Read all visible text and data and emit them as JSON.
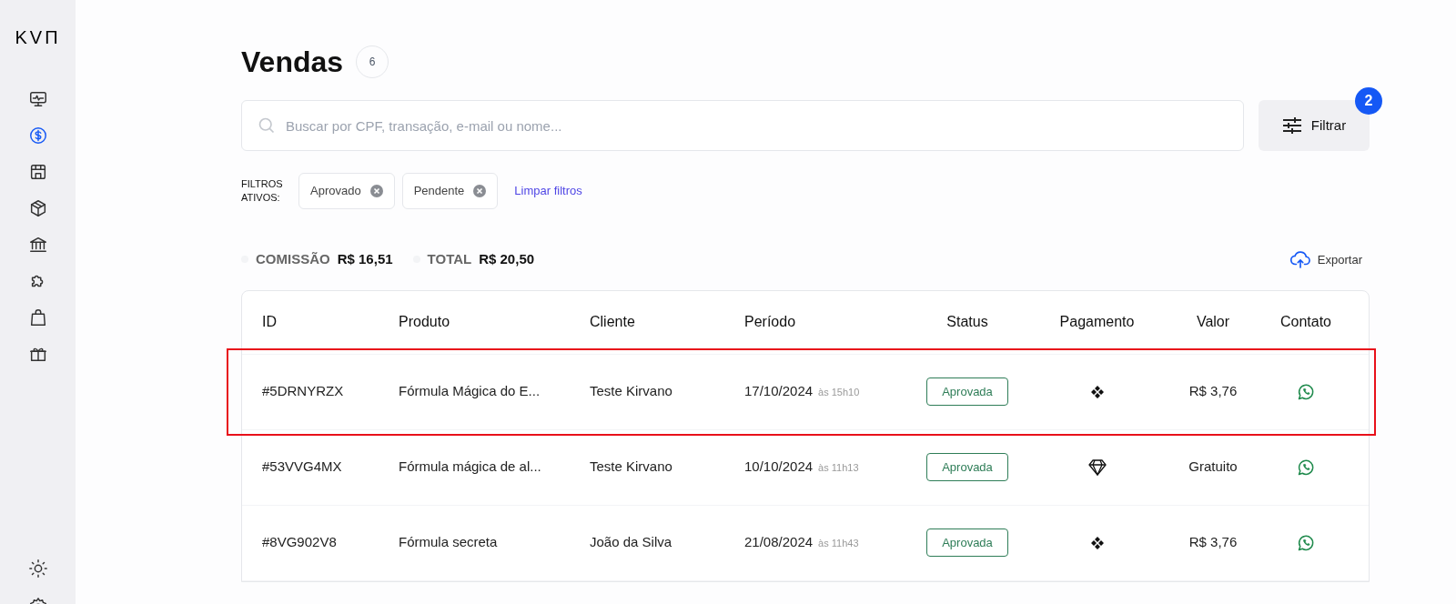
{
  "sidebar": {
    "logo": "KVП",
    "items": [
      {
        "selected": false
      },
      {
        "selected": true
      },
      {
        "selected": false
      },
      {
        "selected": false
      },
      {
        "selected": false
      },
      {
        "selected": false
      },
      {
        "selected": false
      },
      {
        "selected": false
      }
    ]
  },
  "title": "Vendas",
  "count": "6",
  "search": {
    "placeholder": "Buscar por CPF, transação, e-mail ou nome..."
  },
  "filter_button": {
    "label": "Filtrar",
    "badge": "2"
  },
  "active_filters": {
    "label": "FILTROS ATIVOS:",
    "chips": [
      "Aprovado",
      "Pendente"
    ],
    "clear": "Limpar filtros"
  },
  "totals": [
    {
      "label": "COMISSÃO",
      "value": "R$ 16,51"
    },
    {
      "label": "TOTAL",
      "value": "R$ 20,50"
    }
  ],
  "export": "Exportar",
  "table": {
    "columns": [
      "ID",
      "Produto",
      "Cliente",
      "Período",
      "Status",
      "Pagamento",
      "Valor",
      "Contato"
    ],
    "rows": [
      {
        "id": "#5DRNYRZX",
        "product": "Fórmula Mágica do E...",
        "client": "Teste Kirvano",
        "date": "17/10/2024",
        "time": "às 15h10",
        "status": "Aprovada",
        "kind": "pix",
        "value": "R$ 3,76",
        "highlighted": true
      },
      {
        "id": "#53VVG4MX",
        "product": "Fórmula mágica de al...",
        "client": "Teste Kirvano",
        "date": "10/10/2024",
        "time": "às 11h13",
        "status": "Aprovada",
        "kind": "gem",
        "value": "Gratuito",
        "highlighted": false
      },
      {
        "id": "#8VG902V8",
        "product": "Fórmula secreta",
        "client": "João da Silva",
        "date": "21/08/2024",
        "time": "às 11h43",
        "status": "Aprovada",
        "kind": "pix",
        "value": "R$ 3,76",
        "highlighted": false
      }
    ]
  }
}
